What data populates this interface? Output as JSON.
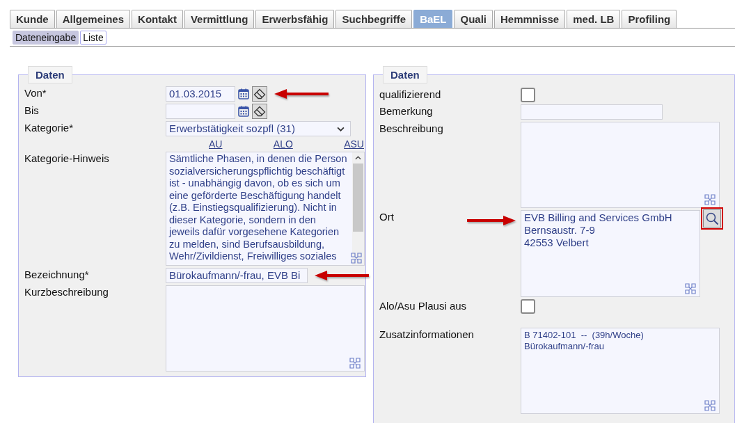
{
  "tabs": [
    {
      "label": "Kunde",
      "selected": false
    },
    {
      "label": "Allgemeines",
      "selected": false
    },
    {
      "label": "Kontakt",
      "selected": false
    },
    {
      "label": "Vermittlung",
      "selected": false
    },
    {
      "label": "Erwerbsfähig",
      "selected": false
    },
    {
      "label": "Suchbegriffe",
      "selected": false
    },
    {
      "label": "BaEL",
      "selected": true
    },
    {
      "label": "Quali",
      "selected": false
    },
    {
      "label": "Hemmnisse",
      "selected": false
    },
    {
      "label": "med. LB",
      "selected": false
    },
    {
      "label": "Profiling",
      "selected": false
    }
  ],
  "subtabs": [
    {
      "label": "Dateneingabe",
      "selected": true
    },
    {
      "label": "Liste",
      "selected": false
    }
  ],
  "panels": [
    {
      "title": "Daten",
      "fields": [
        {
          "kind": "date",
          "label": "Von*",
          "value": "01.03.2015",
          "arrow_left": true
        },
        {
          "kind": "date",
          "label": "Bis"
        },
        {
          "kind": "select",
          "label": "Kategorie*",
          "value": "Erwerbstätigkeit sozpfl (31)"
        },
        {
          "kind": "links",
          "links": [
            "AU",
            "ALO",
            "ASU"
          ]
        },
        {
          "kind": "note",
          "label": "Kategorie-Hinweis",
          "value": "Sämtliche Phasen, in denen die Person sozialversicherungspflichtig beschäftigt ist - unabhängig davon, ob es sich um eine geförderte Beschäftigung handelt (z.B. Einstiegsqualifizierung). Nicht in dieser Kategorie, sondern in den jeweils dafür vorgesehene Kategorien zu melden, sind Berufsausbildung, Wehr/Zivildienst, Freiwilliges soziales"
        },
        {
          "kind": "text",
          "label": "Bezeichnung*",
          "value": "Bürokaufmann/-frau, EVB Bi",
          "arrow_left": true
        },
        {
          "kind": "textarea",
          "label": "Kurzbeschreibung"
        }
      ]
    },
    {
      "title": "Daten",
      "fields": [
        {
          "kind": "checkbox",
          "label": "qualifizierend",
          "checked": false
        },
        {
          "kind": "text",
          "label": "Bemerkung"
        },
        {
          "kind": "textarea",
          "label": "Beschreibung"
        },
        {
          "kind": "address",
          "label": "Ort",
          "lines": [
            "EVB Billing and Services GmbH",
            "Bernsaustr. 7-9",
            "42553 Velbert"
          ],
          "arrow_right": true
        },
        {
          "kind": "checkbox",
          "label": "Alo/Asu Plausi aus",
          "checked": false
        },
        {
          "kind": "textarea",
          "label": "Zusatzinformationen",
          "lines": [
            "B 71402-101  --  (39h/Woche)",
            "Bürokaufmann/-frau"
          ]
        }
      ]
    }
  ]
}
